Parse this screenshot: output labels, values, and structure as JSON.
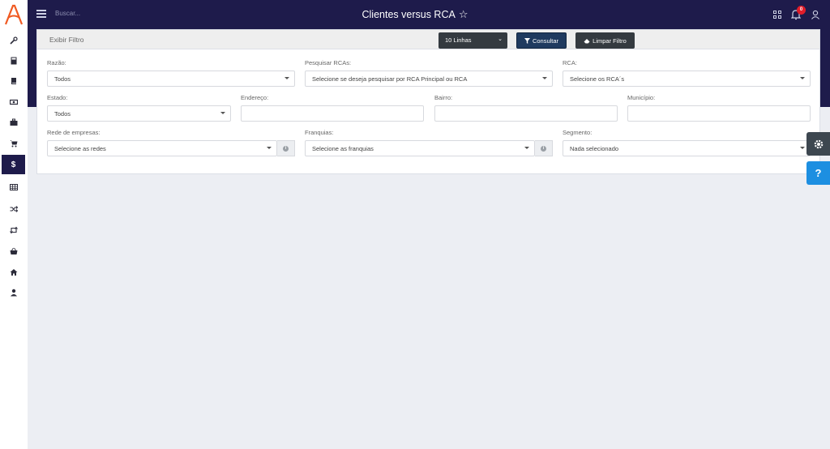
{
  "header": {
    "search_placeholder": "Buscar...",
    "title": "Clientes versus RCA",
    "notifications_count": "0"
  },
  "sidebar": {
    "items": [
      {
        "icon": "wrench-icon"
      },
      {
        "icon": "calculator-icon"
      },
      {
        "icon": "book-icon"
      },
      {
        "icon": "money-icon"
      },
      {
        "icon": "briefcase-icon"
      },
      {
        "icon": "cart-icon"
      },
      {
        "icon": "dollar-icon",
        "label": "$",
        "active": true
      },
      {
        "icon": "table-icon"
      },
      {
        "icon": "shuffle-icon"
      },
      {
        "icon": "retweet-icon"
      },
      {
        "icon": "basket-icon"
      },
      {
        "icon": "home-icon"
      },
      {
        "icon": "user-icon"
      }
    ]
  },
  "toolbar": {
    "toggle_filter": "Exibir Filtro",
    "lines": "10 Linhas",
    "consultar": "Consultar",
    "limpar": "Limpar Filtro"
  },
  "filters": {
    "razao": {
      "label": "Razão:",
      "value": "Todos"
    },
    "pesquisar_rcas": {
      "label": "Pesquisar RCAs:",
      "value": "Selecione se deseja pesquisar por RCA Principal ou RCA"
    },
    "rca": {
      "label": "RCA:",
      "value": "Selecione os RCA´s"
    },
    "estado": {
      "label": "Estado:",
      "value": "Todos"
    },
    "endereco": {
      "label": "Endereço:",
      "value": ""
    },
    "bairro": {
      "label": "Bairro:",
      "value": ""
    },
    "municipio": {
      "label": "Município:",
      "value": ""
    },
    "rede": {
      "label": "Rede de empresas:",
      "value": "Selecione as redes"
    },
    "franquias": {
      "label": "Franquias:",
      "value": "Selecione as franquias"
    },
    "segmento": {
      "label": "Segmento:",
      "value": "Nada selecionado"
    }
  },
  "colors": {
    "primary_dark": "#1e1b4b",
    "help_blue": "#1d8fe1",
    "badge_red": "#e11d2a"
  }
}
